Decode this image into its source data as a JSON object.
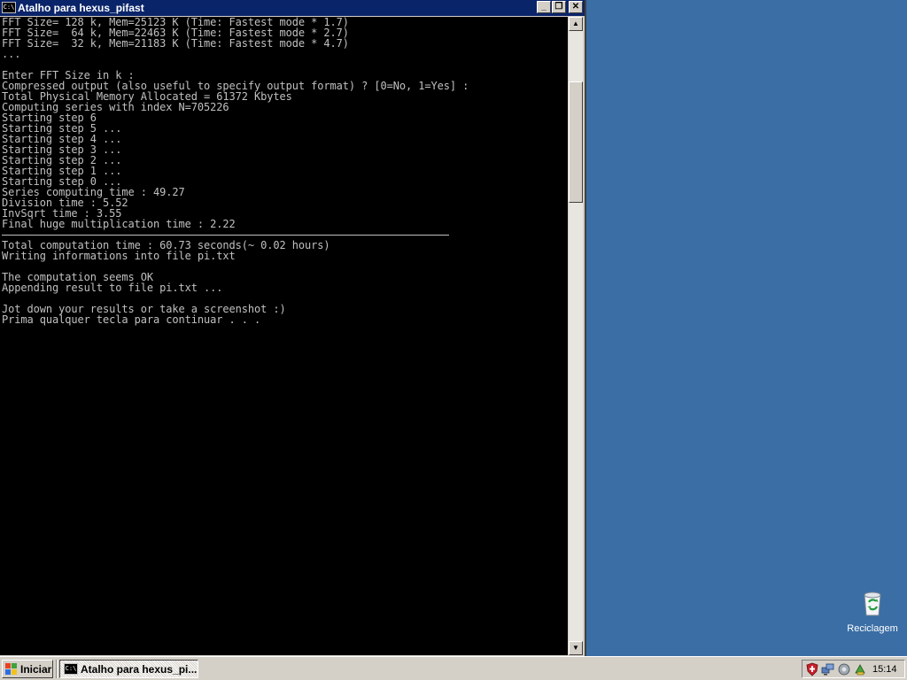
{
  "window": {
    "title": "Atalho para hexus_pifast",
    "icon_text": "C:\\",
    "buttons": {
      "minimize": "_",
      "maximize": "❐",
      "close": "✕"
    }
  },
  "console": {
    "lines": [
      "FFT Size= 128 k, Mem=25123 K (Time: Fastest mode * 1.7)",
      "FFT Size=  64 k, Mem=22463 K (Time: Fastest mode * 2.7)",
      "FFT Size=  32 k, Mem=21183 K (Time: Fastest mode * 4.7)",
      "...",
      "",
      "Enter FFT Size in k :",
      "Compressed output (also useful to specify output format) ? [0=No, 1=Yes] :",
      "Total Physical Memory Allocated = 61372 Kbytes",
      "Computing series with index N=705226",
      "Starting step 6",
      "Starting step 5 ...",
      "Starting step 4 ...",
      "Starting step 3 ...",
      "Starting step 2 ...",
      "Starting step 1 ...",
      "Starting step 0 ...",
      "Series computing time : 49.27",
      "Division time : 5.52",
      "InvSqrt time : 3.55",
      "Final huge multiplication time : 2.22",
      "---",
      "Total computation time : 60.73 seconds(~ 0.02 hours)",
      "Writing informations into file pi.txt",
      "",
      "The computation seems OK",
      "Appending result to file pi.txt ...",
      "",
      "Jot down your results or take a screenshot :)",
      "Prima qualquer tecla para continuar . . ."
    ]
  },
  "scrollbar": {
    "up_arrow": "▲",
    "down_arrow": "▼"
  },
  "desktop": {
    "recycle_bin_label": "Reciclagem",
    "icons": [
      "recycle-bin-icon"
    ]
  },
  "taskbar": {
    "start_label": "Iniciar",
    "task_label": "Atalho para hexus_pi...",
    "task_icon_text": "C:\\",
    "clock": "15:14",
    "tray_icons": [
      "shield-icon",
      "network-icon",
      "volume-icon",
      "update-icon"
    ]
  },
  "colors": {
    "desktop_background": "#3a6ea5",
    "titlebar": "#0a246a",
    "console_background": "#000000",
    "console_text": "#c0c0c0",
    "chrome": "#d4d0c8"
  }
}
